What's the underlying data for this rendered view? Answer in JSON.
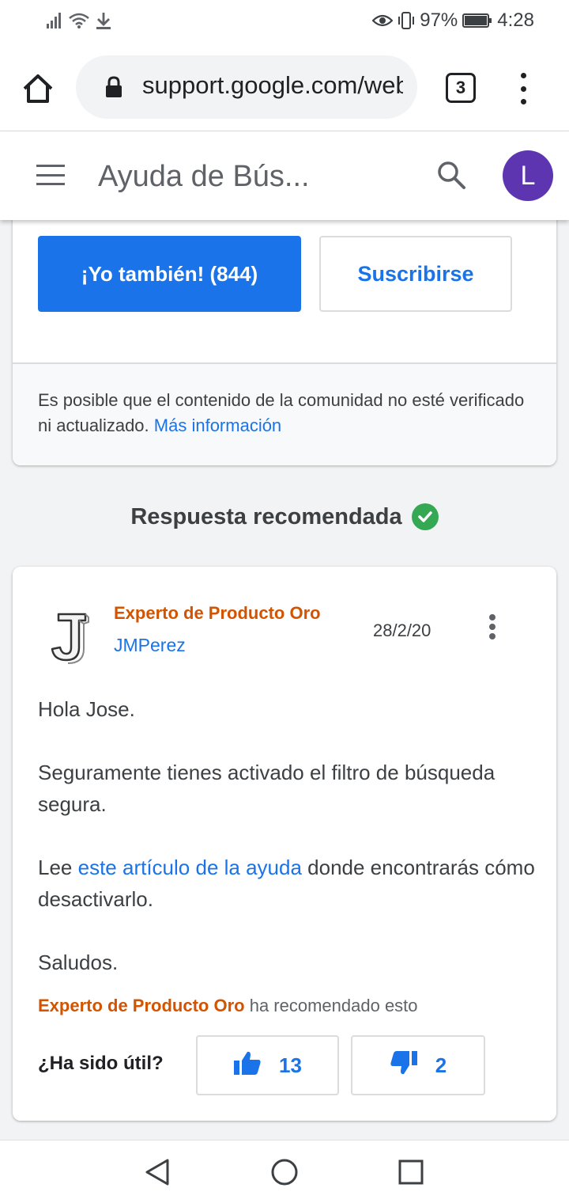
{
  "status_bar": {
    "battery": "97%",
    "time": "4:28"
  },
  "browser": {
    "url": "support.google.com/web",
    "tab_count": "3"
  },
  "header": {
    "title": "Ayuda de Bús...",
    "avatar_letter": "L"
  },
  "question_card": {
    "me_too_label": "¡Yo también! (844)",
    "subscribe_label": "Suscribirse",
    "disclaimer_text": "Es posible que el contenido de la comunidad no esté verificado ni actualizado.",
    "disclaimer_link": "Más información"
  },
  "recommended_heading": "Respuesta recomendada",
  "answer": {
    "badge": "Experto de Producto Oro",
    "author": "JMPerez",
    "date": "28/2/20",
    "greeting": "Hola Jose.",
    "paragraph1": "Seguramente tienes activado el filtro de búsqueda segura.",
    "paragraph2_prefix": "Lee",
    "paragraph2_link": "este artículo de la ayuda",
    "paragraph2_suffix": "donde encontrarás cómo desactivarlo.",
    "closing": "Saludos.",
    "recommended_by": "Experto de Producto Oro",
    "recommended_suffix": "ha recomendado esto",
    "useful_question": "¿Ha sido útil?",
    "thumbs_up_count": "13",
    "thumbs_down_count": "2"
  },
  "colors": {
    "accent": "#1a73e8",
    "expert": "#d35400",
    "avatar": "#5e35b1",
    "check": "#34a853"
  }
}
